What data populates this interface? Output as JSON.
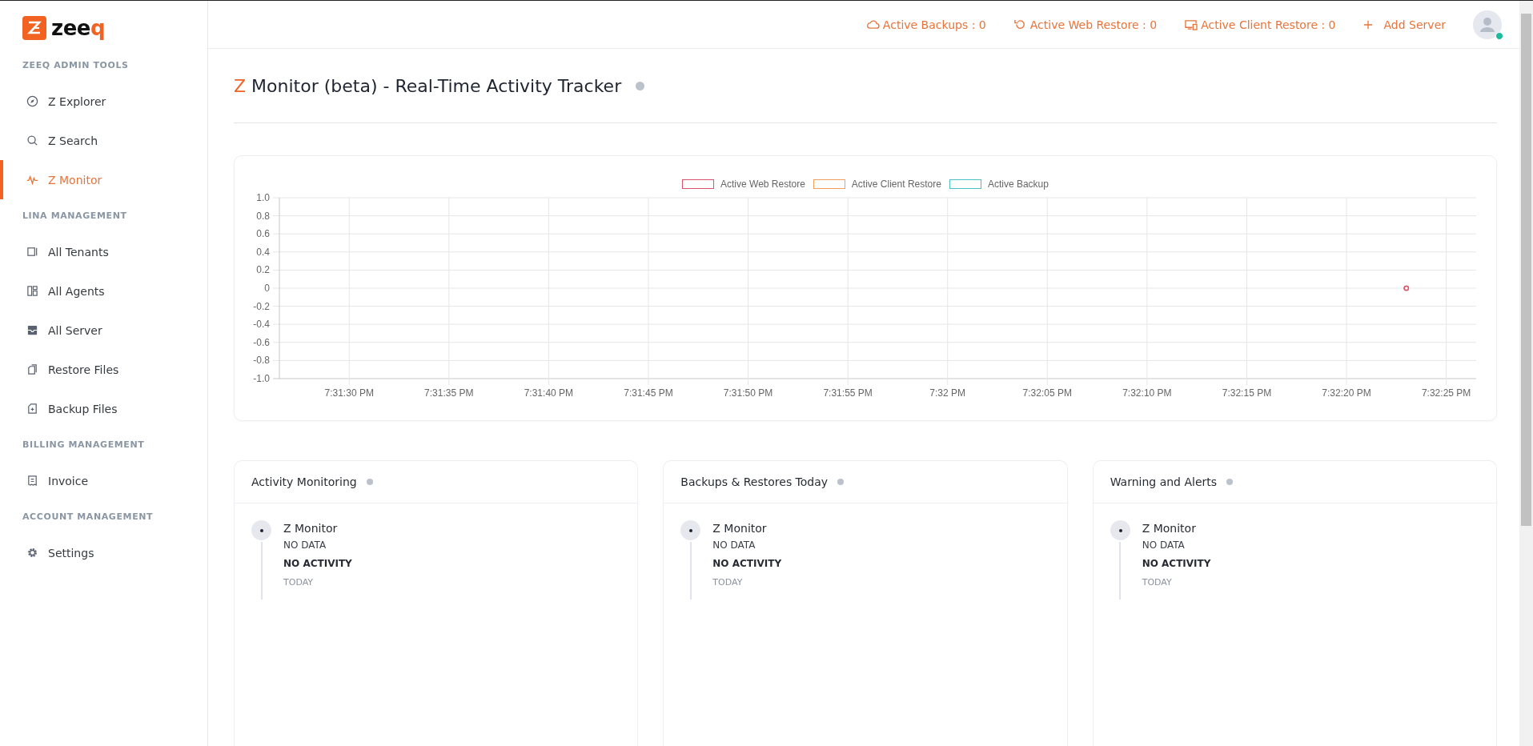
{
  "sidebar": {
    "logo": {
      "wordmark": "zeeq"
    },
    "sections": [
      {
        "title": "ZEEQ ADMIN TOOLS",
        "items": [
          {
            "label": "Z Explorer",
            "kind": "compass",
            "selected": false
          },
          {
            "label": "Z Search",
            "kind": "search",
            "selected": false
          },
          {
            "label": "Z Monitor",
            "kind": "pulse",
            "selected": true
          }
        ]
      },
      {
        "title": "LINA MANAGEMENT",
        "items": [
          {
            "label": "All Tenants",
            "kind": "tenants",
            "selected": false
          },
          {
            "label": "All Agents",
            "kind": "agents",
            "selected": false
          },
          {
            "label": "All Server",
            "kind": "server",
            "selected": false
          },
          {
            "label": "Restore Files",
            "kind": "restore",
            "selected": false
          },
          {
            "label": "Backup Files",
            "kind": "backup",
            "selected": false
          }
        ]
      },
      {
        "title": "BILLING MANAGEMENT",
        "items": [
          {
            "label": "Invoice",
            "kind": "invoice",
            "selected": false
          }
        ]
      },
      {
        "title": "ACCOUNT MANAGEMENT",
        "items": [
          {
            "label": "Settings",
            "kind": "gear",
            "selected": false
          }
        ]
      }
    ]
  },
  "header": {
    "stats": [
      {
        "label": "Active Backups : 0",
        "kind": "cloud"
      },
      {
        "label": "Active Web Restore : 0",
        "kind": "undo"
      },
      {
        "label": "Active Client Restore : 0",
        "kind": "devices"
      }
    ],
    "add_server": {
      "label": "Add Server"
    },
    "avatar": {
      "online": true
    }
  },
  "page": {
    "title_prefix": "Z",
    "title": "Monitor (beta) - Real-Time Activity Tracker"
  },
  "chart": {
    "chart_data": {
      "type": "line",
      "grid": true,
      "categories": [
        null,
        null,
        null,
        "7:31:30 PM",
        null,
        null,
        null,
        null,
        "7:31:35 PM",
        null,
        null,
        null,
        null,
        "7:31:40 PM",
        null,
        null,
        null,
        null,
        "7:31:45 PM",
        null,
        null,
        null,
        null,
        "7:31:50 PM",
        null,
        null,
        null,
        null,
        "7:31:55 PM",
        null,
        null,
        null,
        null,
        "7:32 PM",
        null,
        null,
        null,
        null,
        "7:32:05 PM",
        null,
        null,
        null,
        null,
        "7:32:10 PM",
        null,
        null,
        null,
        null,
        "7:32:15 PM",
        null,
        null,
        null,
        null,
        "7:32:20 PM",
        null,
        null,
        null,
        null,
        "7:32:25 PM",
        null
      ],
      "series": [
        {
          "name": "Active Web Restore",
          "color": "#d9556b",
          "marker": true,
          "values": [
            null,
            null,
            null,
            null,
            null,
            null,
            null,
            null,
            null,
            null,
            null,
            null,
            null,
            null,
            null,
            null,
            null,
            null,
            null,
            null,
            null,
            null,
            null,
            null,
            null,
            null,
            null,
            null,
            null,
            null,
            null,
            null,
            null,
            null,
            null,
            null,
            null,
            null,
            null,
            null,
            null,
            null,
            null,
            null,
            null,
            null,
            null,
            null,
            null,
            null,
            null,
            null,
            null,
            null,
            null,
            null,
            0,
            null,
            null,
            null
          ]
        },
        {
          "name": "Active Client Restore",
          "color": "#f0a05c",
          "marker": true,
          "values": [
            null,
            null,
            null,
            null,
            null,
            null,
            null,
            null,
            null,
            null,
            null,
            null,
            null,
            null,
            null,
            null,
            null,
            null,
            null,
            null,
            null,
            null,
            null,
            null,
            null,
            null,
            null,
            null,
            null,
            null,
            null,
            null,
            null,
            null,
            null,
            null,
            null,
            null,
            null,
            null,
            null,
            null,
            null,
            null,
            null,
            null,
            null,
            null,
            null,
            null,
            null,
            null,
            null,
            null,
            null,
            null,
            0,
            null,
            null,
            null
          ]
        },
        {
          "name": "Active Backup",
          "color": "#4bc0c4",
          "marker": true,
          "values": [
            null,
            null,
            null,
            null,
            null,
            null,
            null,
            null,
            null,
            null,
            null,
            null,
            null,
            null,
            null,
            null,
            null,
            null,
            null,
            null,
            null,
            null,
            null,
            null,
            null,
            null,
            null,
            null,
            null,
            null,
            null,
            null,
            null,
            null,
            null,
            null,
            null,
            null,
            null,
            null,
            null,
            null,
            null,
            null,
            null,
            null,
            null,
            null,
            null,
            null,
            null,
            null,
            null,
            null,
            null,
            null,
            0,
            null,
            null,
            null
          ]
        }
      ],
      "ylim": [
        -1,
        1
      ],
      "yticks": [
        {
          "value": 1,
          "label": "1.0"
        },
        {
          "value": 0.8,
          "label": "0.8"
        },
        {
          "value": 0.6,
          "label": "0.6"
        },
        {
          "value": 0.4,
          "label": "0.4"
        },
        {
          "value": 0.2,
          "label": "0.2"
        },
        {
          "value": 0,
          "label": "0"
        },
        {
          "value": -0.2,
          "label": "-0.2"
        },
        {
          "value": -0.4,
          "label": "-0.4"
        },
        {
          "value": -0.6,
          "label": "-0.6"
        },
        {
          "value": -0.8,
          "label": "-0.8"
        },
        {
          "value": -1,
          "label": "-1.0"
        }
      ]
    }
  },
  "cards": [
    {
      "title": "Activity Monitoring",
      "entries": [
        {
          "name": "Z Monitor",
          "status": "NO DATA",
          "activity": "NO ACTIVITY",
          "when": "TODAY"
        }
      ]
    },
    {
      "title": "Backups & Restores Today",
      "entries": [
        {
          "name": "Z Monitor",
          "status": "NO DATA",
          "activity": "NO ACTIVITY",
          "when": "TODAY"
        }
      ]
    },
    {
      "title": "Warning and Alerts",
      "entries": [
        {
          "name": "Z Monitor",
          "status": "NO DATA",
          "activity": "NO ACTIVITY",
          "when": "TODAY"
        }
      ]
    }
  ]
}
